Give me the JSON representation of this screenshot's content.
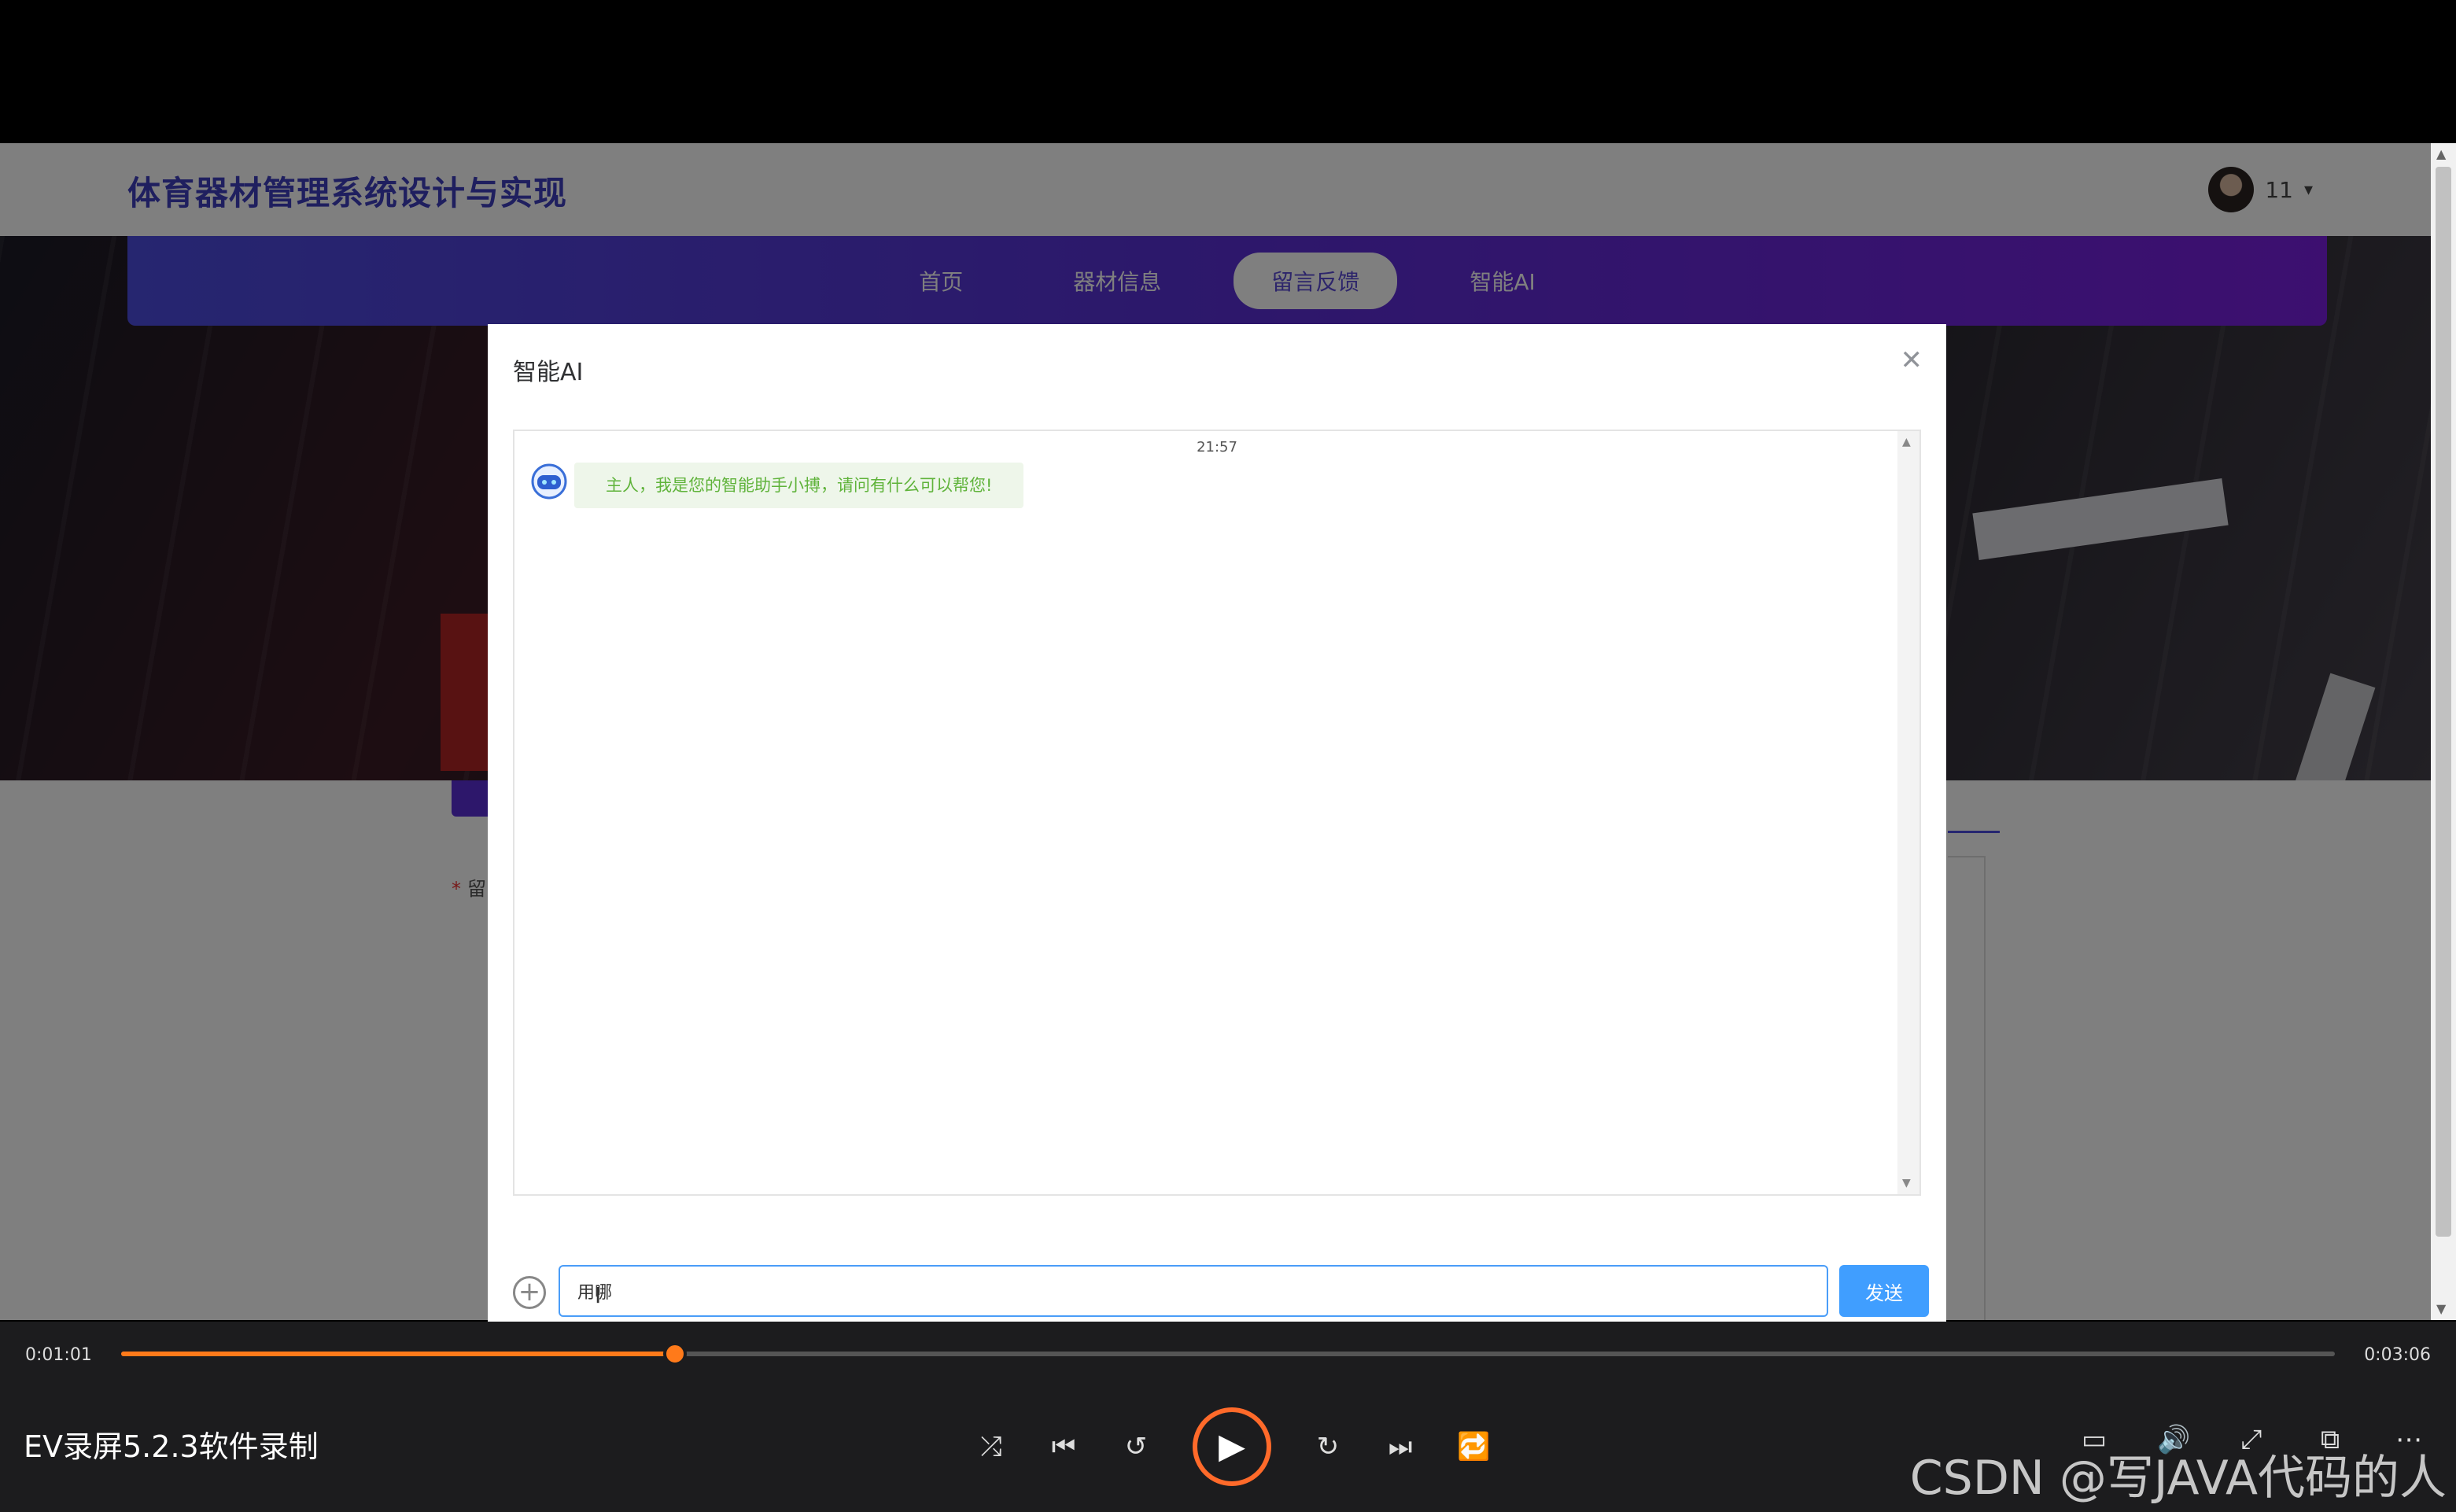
{
  "site": {
    "title": "体育器材管理系统设计与实现",
    "user_name": "11"
  },
  "nav": {
    "items": [
      {
        "label": "首页",
        "active": false
      },
      {
        "label": "器材信息",
        "active": false
      },
      {
        "label": "留言反馈",
        "active": true
      },
      {
        "label": "智能AI",
        "active": false
      }
    ]
  },
  "form": {
    "partial_label": "留"
  },
  "dialog": {
    "title": "智能AI",
    "close_icon": "close-icon",
    "chat": {
      "time": "21:57",
      "bot_message": "主人，我是您的智能助手小搏，请问有什么可以帮您!"
    },
    "input_value": "用哪",
    "send_label": "发送"
  },
  "player": {
    "current_time": "0:01:01",
    "total_time": "0:03:06",
    "progress": 0.25,
    "title": "EV录屏5.2.3软件录制",
    "accent": "#ff7a1a"
  },
  "watermark": "CSDN @写JAVA代码的人"
}
